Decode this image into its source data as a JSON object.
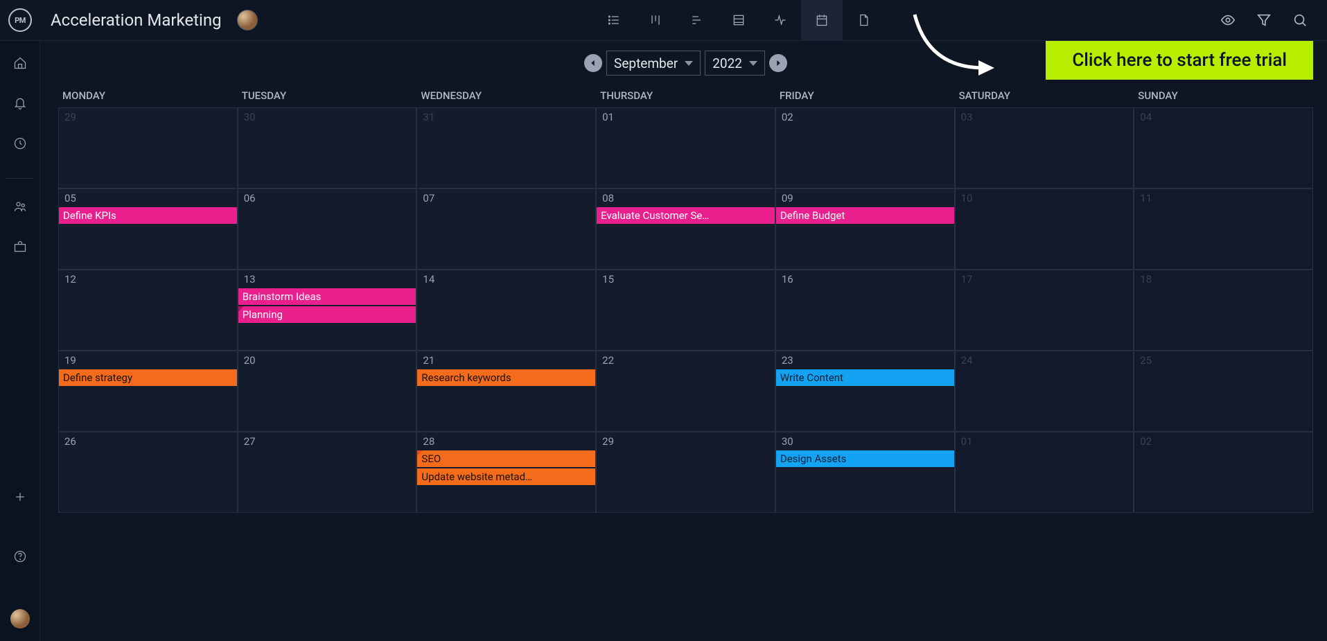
{
  "header": {
    "logo_text": "PM",
    "project_title": "Acceleration Marketing"
  },
  "cta": {
    "label": "Click here to start free trial"
  },
  "date_controls": {
    "month": "September",
    "year": "2022"
  },
  "days_of_week": [
    "MONDAY",
    "TUESDAY",
    "WEDNESDAY",
    "THURSDAY",
    "FRIDAY",
    "SATURDAY",
    "SUNDAY"
  ],
  "cells": [
    {
      "num": "29",
      "muted": true
    },
    {
      "num": "30",
      "muted": true
    },
    {
      "num": "31",
      "muted": true
    },
    {
      "num": "01"
    },
    {
      "num": "02"
    },
    {
      "num": "03",
      "muted": true,
      "weekend": true
    },
    {
      "num": "04",
      "muted": true,
      "weekend": true
    },
    {
      "num": "05",
      "tasks": [
        {
          "label": "Define KPIs",
          "color": "pink"
        }
      ]
    },
    {
      "num": "06"
    },
    {
      "num": "07"
    },
    {
      "num": "08",
      "tasks": [
        {
          "label": "Evaluate Customer Se…",
          "color": "pink"
        }
      ]
    },
    {
      "num": "09",
      "tasks": [
        {
          "label": "Define Budget",
          "color": "pink"
        }
      ]
    },
    {
      "num": "10",
      "muted": true,
      "weekend": true
    },
    {
      "num": "11",
      "muted": true,
      "weekend": true
    },
    {
      "num": "12"
    },
    {
      "num": "13",
      "tasks": [
        {
          "label": "Brainstorm Ideas",
          "color": "pink"
        },
        {
          "label": "Planning",
          "color": "pink",
          "flag": true
        }
      ]
    },
    {
      "num": "14"
    },
    {
      "num": "15"
    },
    {
      "num": "16"
    },
    {
      "num": "17",
      "muted": true,
      "weekend": true
    },
    {
      "num": "18",
      "muted": true,
      "weekend": true
    },
    {
      "num": "19",
      "tasks": [
        {
          "label": "Define strategy",
          "color": "orange"
        }
      ]
    },
    {
      "num": "20"
    },
    {
      "num": "21",
      "tasks": [
        {
          "label": "Research keywords",
          "color": "orange"
        }
      ]
    },
    {
      "num": "22"
    },
    {
      "num": "23",
      "tasks": [
        {
          "label": "Write Content",
          "color": "blue"
        }
      ]
    },
    {
      "num": "24",
      "muted": true,
      "weekend": true
    },
    {
      "num": "25",
      "muted": true,
      "weekend": true
    },
    {
      "num": "26"
    },
    {
      "num": "27"
    },
    {
      "num": "28",
      "tasks": [
        {
          "label": "SEO",
          "color": "orange",
          "flag": true
        },
        {
          "label": "Update website metad…",
          "color": "orange"
        }
      ]
    },
    {
      "num": "29"
    },
    {
      "num": "30",
      "tasks": [
        {
          "label": "Design Assets",
          "color": "blue"
        }
      ]
    },
    {
      "num": "01",
      "muted": true,
      "weekend": true
    },
    {
      "num": "02",
      "muted": true,
      "weekend": true
    }
  ]
}
